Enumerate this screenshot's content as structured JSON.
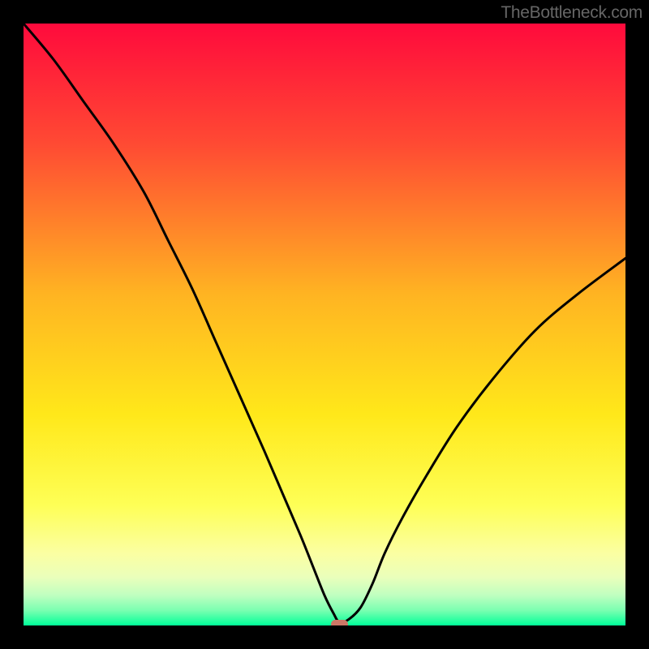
{
  "watermark": "TheBottleneck.com",
  "chart_data": {
    "type": "line",
    "title": "",
    "xlabel": "",
    "ylabel": "",
    "xlim": [
      0,
      100
    ],
    "ylim": [
      0,
      100
    ],
    "background": {
      "type": "vertical-gradient",
      "stops": [
        {
          "offset": 0,
          "color": "#ff0a3c"
        },
        {
          "offset": 20,
          "color": "#ff4a33"
        },
        {
          "offset": 45,
          "color": "#ffb422"
        },
        {
          "offset": 65,
          "color": "#ffe81a"
        },
        {
          "offset": 80,
          "color": "#feff56"
        },
        {
          "offset": 88,
          "color": "#fbffa2"
        },
        {
          "offset": 92,
          "color": "#eaffbb"
        },
        {
          "offset": 95,
          "color": "#bfffc0"
        },
        {
          "offset": 97.5,
          "color": "#7affb1"
        },
        {
          "offset": 100,
          "color": "#00ff99"
        }
      ]
    },
    "series": [
      {
        "name": "bottleneck-curve",
        "x": [
          0,
          5,
          10,
          15,
          20,
          24,
          28,
          32,
          36,
          40,
          43,
          46,
          48,
          50,
          51.5,
          52.5,
          54,
          56,
          58,
          60,
          63,
          67,
          72,
          78,
          85,
          92,
          100
        ],
        "y": [
          100,
          94,
          87,
          80,
          72,
          64,
          56,
          47,
          38,
          29,
          22,
          15,
          10,
          5,
          2,
          0.5,
          1,
          3,
          7,
          12,
          18,
          25,
          33,
          41,
          49,
          55,
          61
        ],
        "color": "#000000",
        "width": 3
      }
    ],
    "marker": {
      "x": 52.5,
      "y": 0.2,
      "width_pct": 2.8,
      "height_pct": 1.5,
      "color": "#cc7766"
    }
  }
}
